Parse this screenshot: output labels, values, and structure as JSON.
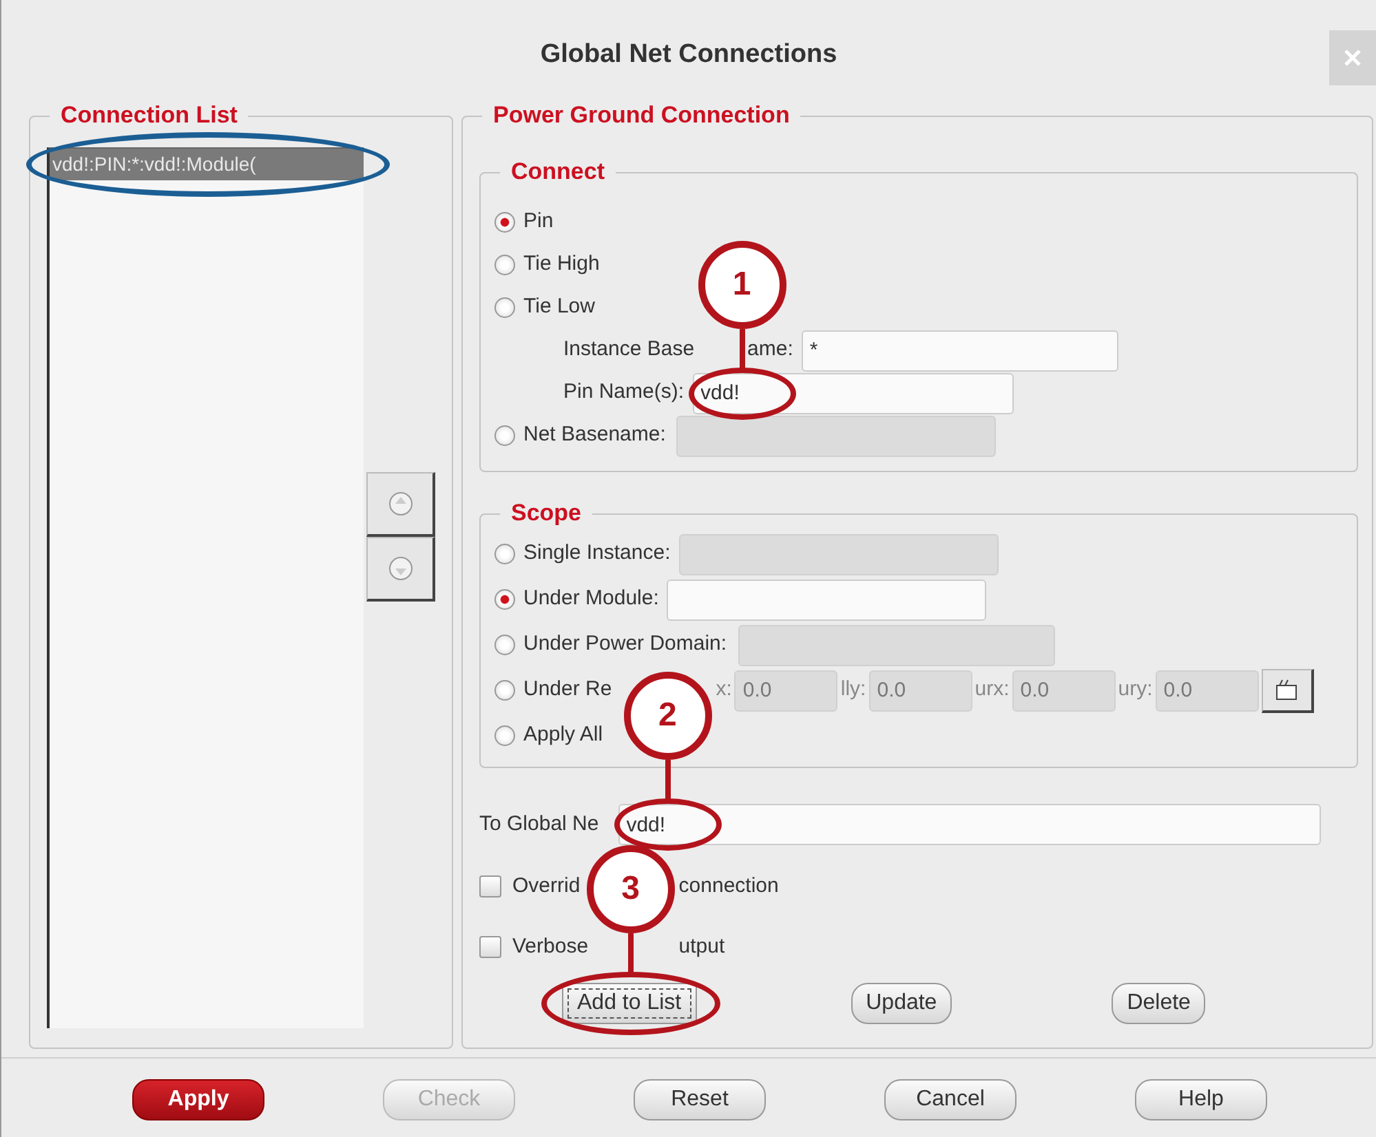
{
  "window": {
    "title": "Global Net Connections"
  },
  "connection_list": {
    "title": "Connection List",
    "items": [
      {
        "text": "vdd!:PIN:*:vdd!:Module(",
        "selected": true
      }
    ]
  },
  "power_ground": {
    "title": "Power Ground Connection",
    "connect": {
      "title": "Connect",
      "rows": [
        {
          "kind": "radio",
          "label": "Pin",
          "selected": true
        },
        {
          "kind": "radio",
          "label": "Tie High",
          "selected": false
        },
        {
          "kind": "radio",
          "label": "Tie Low",
          "selected": false
        },
        {
          "kind": "field",
          "label_parts": [
            "Instance Base",
            "ame:"
          ],
          "value": "*",
          "enabled": true
        },
        {
          "kind": "field",
          "label_parts": [
            "Pin Name(s):"
          ],
          "value": "vdd!",
          "enabled": true
        },
        {
          "kind": "radio",
          "label": "Net Basename:",
          "selected": false,
          "field": {
            "enabled": false
          }
        }
      ]
    },
    "scope": {
      "title": "Scope",
      "rows": [
        {
          "kind": "radio",
          "label": "Single Instance:",
          "selected": false,
          "field": {
            "enabled": false
          }
        },
        {
          "kind": "radio",
          "label": "Under Module:",
          "selected": true,
          "field": {
            "enabled": true
          }
        },
        {
          "kind": "radio",
          "label": "Under Power Domain:",
          "selected": false,
          "field": {
            "enabled": false
          }
        },
        {
          "kind": "region",
          "label": "Under Re",
          "selected": false,
          "coords": [
            {
              "label": "x:",
              "value": "0.0"
            },
            {
              "label": "lly:",
              "value": "0.0"
            },
            {
              "label": "urx:",
              "value": "0.0"
            },
            {
              "label": "ury:",
              "value": "0.0"
            }
          ]
        },
        {
          "kind": "radio",
          "label": "Apply All",
          "selected": false
        }
      ]
    },
    "to_global_net": {
      "label": "To Global Ne",
      "value": "vdd!"
    },
    "checkboxes": [
      {
        "parts": [
          "Overrid",
          "connection"
        ],
        "checked": false
      },
      {
        "parts": [
          "Verbose",
          "utput"
        ],
        "checked": false
      }
    ],
    "buttons": [
      {
        "label": "Add to List",
        "focused": true
      },
      {
        "label": "Update",
        "focused": false
      },
      {
        "label": "Delete",
        "focused": false
      }
    ]
  },
  "footer_buttons": [
    {
      "label": "Apply",
      "kind": "primary"
    },
    {
      "label": "Check",
      "kind": "disabled"
    },
    {
      "label": "Reset",
      "kind": "normal"
    },
    {
      "label": "Cancel",
      "kind": "normal"
    },
    {
      "label": "Help",
      "kind": "normal"
    }
  ],
  "annotations": {
    "callouts": [
      {
        "number": "1"
      },
      {
        "number": "2"
      },
      {
        "number": "3"
      }
    ],
    "highlights": [
      {
        "color": "#1b5e94"
      },
      {
        "color": "#b3141c"
      },
      {
        "color": "#b3141c"
      },
      {
        "color": "#b3141c"
      }
    ]
  }
}
